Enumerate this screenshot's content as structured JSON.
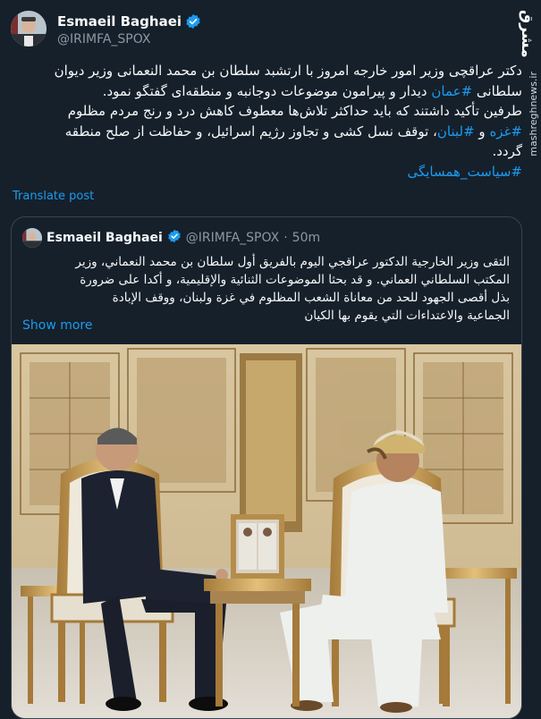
{
  "author": {
    "display_name": "Esmaeil Baghaei",
    "handle": "@IRIMFA_SPOX",
    "verified": true
  },
  "tweet": {
    "line1": "دکتر عراقچی وزیر امور خارجه امروز با ارتشبد سلطان بن محمد النعمانی وزیر دیوان",
    "line2_pre": "سلطانی ",
    "line2_tag": "#عمان",
    "line2_post": " دیدار و پیرامون موضوعات دوجانبه و منطقه‌ای گفتگو نمود.",
    "line3": "طرفین تأکید داشتند که باید حداکثر تلاش‌ها معطوف کاهش درد و رنج مردم مظلوم",
    "line4_tag1": "#غزه",
    "line4_and": " و ",
    "line4_tag2": "#لبنان",
    "line4_post": "، توقف نسل کشی و تجاوز رژیم اسرائیل، و حفاظت از صلح منطقه",
    "line5": "گردد.",
    "hashtag_footer": "#سیاست_همسایگی",
    "translate_label": "Translate post"
  },
  "quote": {
    "display_name": "Esmaeil Baghaei",
    "handle": "@IRIMFA_SPOX",
    "separator": "·",
    "time": "50m",
    "line1": "التقى وزير الخارجية الدكتور عراقجي اليوم بالفريق أول سلطان بن محمد النعماني، وزير",
    "line2": "المكتب السلطاني العماني. و قد بحثا الموضوعات الثنائية والإقليمية، و أكدا على ضرورة",
    "line3": "بذل أقصى الجهود للحد من معاناة الشعب المظلوم في غزة ولبنان، ووقف الإبادة",
    "line4": "الجماعية والاعتداءات التي يقوم بها الكيان",
    "show_more": "Show more"
  },
  "watermark": {
    "logo_text": "مشرق",
    "url": "mashreghnews.ir"
  },
  "colors": {
    "background": "#15202b",
    "link": "#1d9bf0",
    "verified": "#1d9bf0",
    "secondary_text": "#8b98a5",
    "border": "#38444d"
  },
  "icons": {
    "verified": "verified-badge-icon"
  }
}
